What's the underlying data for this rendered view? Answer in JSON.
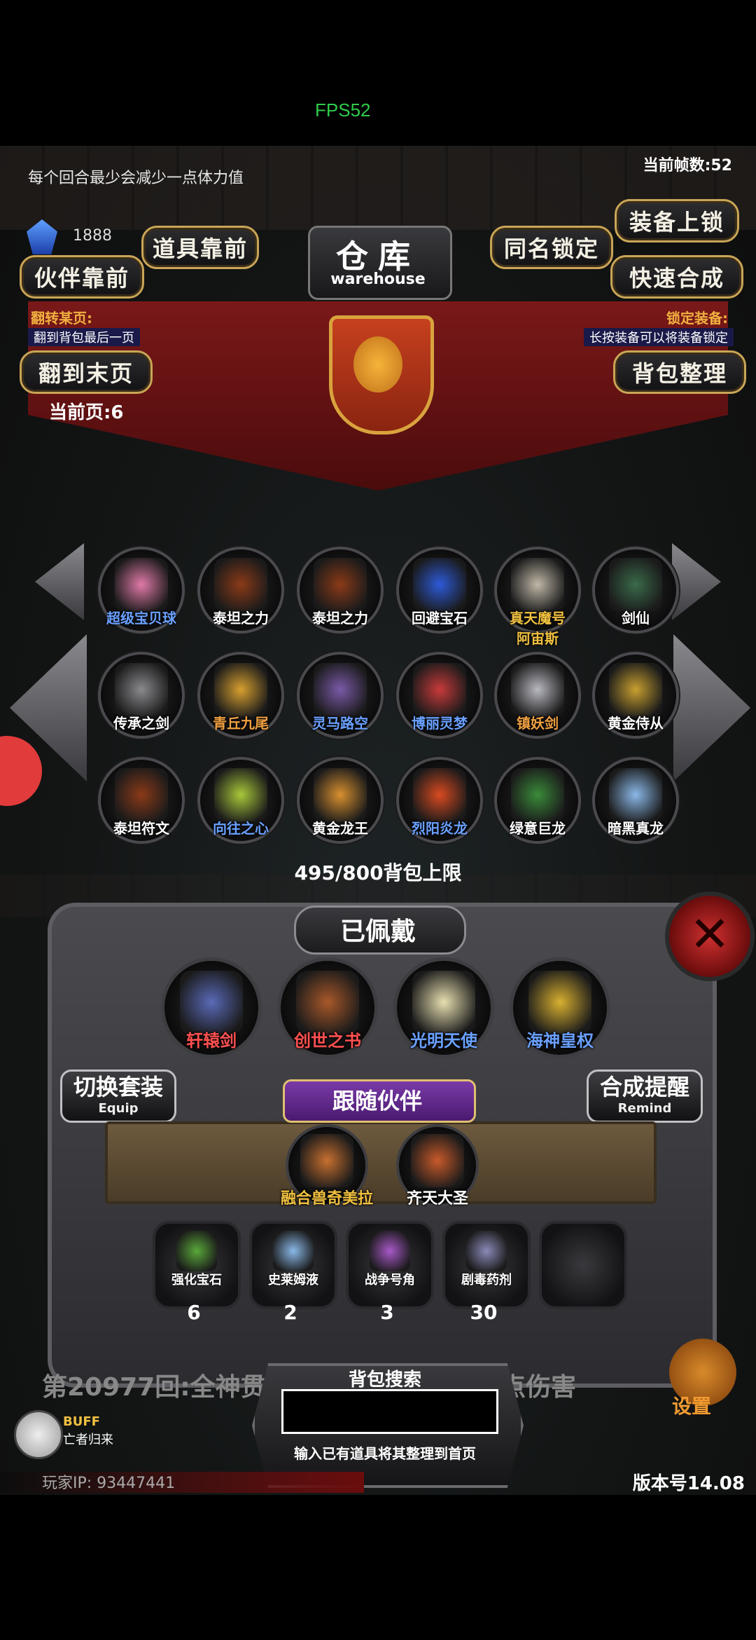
{
  "status_bar": {
    "fps": "FPS52"
  },
  "top": {
    "hint": "每个回合最少会减少一点体力值",
    "frame_rate": "当前帧数:52",
    "gem_value": "1888"
  },
  "buttons": {
    "items_front": "道具靠前",
    "partner_front": "伙伴靠前",
    "same_name_lock": "同名锁定",
    "equip_lock": "装备上锁",
    "quick_synth": "快速合成",
    "flip_last": "翻到末页",
    "bag_sort": "背包整理"
  },
  "warehouse": {
    "title": "仓库",
    "subtitle": "warehouse"
  },
  "notes": {
    "flip_title": "翻转某页:",
    "flip_desc": "翻到背包最后一页",
    "lock_title": "锁定装备:",
    "lock_desc": "长按装备可以将装备锁定"
  },
  "current_page": "当前页:6",
  "grid_items": [
    {
      "label": "超级宝贝球",
      "color": "#6aa0ff",
      "icon": "pokeball-icon",
      "tint": "#e07aa8"
    },
    {
      "label": "泰坦之力",
      "color": "#ffffff",
      "icon": "titan-stone-icon",
      "tint": "#8a3a18"
    },
    {
      "label": "泰坦之力",
      "color": "#ffffff",
      "icon": "titan-stone-icon",
      "tint": "#8a3a18"
    },
    {
      "label": "回避宝石",
      "color": "#ffffff",
      "icon": "blue-orb-icon",
      "tint": "#2d5ad8"
    },
    {
      "label": "真天魔号\n阿宙斯",
      "color": "#f0c040",
      "icon": "arceus-icon",
      "tint": "#c0b8a8"
    },
    {
      "label": "剑仙",
      "color": "#ffffff",
      "icon": "sword-immortal-icon",
      "tint": "#3a6a4a"
    },
    {
      "label": "传承之剑",
      "color": "#ffffff",
      "icon": "sword-icon",
      "tint": "#8a8a8e"
    },
    {
      "label": "青丘九尾",
      "color": "#f0a040",
      "icon": "nine-tail-fox-icon",
      "tint": "#d8a030"
    },
    {
      "label": "灵马路空",
      "color": "#6aa0ff",
      "icon": "spirit-horse-icon",
      "tint": "#7a5aa8"
    },
    {
      "label": "博丽灵梦",
      "color": "#6aa0ff",
      "icon": "reimu-icon",
      "tint": "#c83a3a"
    },
    {
      "label": "镇妖剑",
      "color": "#f0a040",
      "icon": "demon-sword-icon",
      "tint": "#b8b8c0"
    },
    {
      "label": "黄金侍从",
      "color": "#ffffff",
      "icon": "golden-servant-icon",
      "tint": "#c8a030"
    },
    {
      "label": "泰坦符文",
      "color": "#ffffff",
      "icon": "titan-rune-icon",
      "tint": "#8a3a18"
    },
    {
      "label": "向往之心",
      "color": "#6aa0ff",
      "icon": "heart-icon",
      "tint": "#a8c83a"
    },
    {
      "label": "黄金龙王",
      "color": "#ffffff",
      "icon": "golden-dragon-icon",
      "tint": "#d89030"
    },
    {
      "label": "烈阳炎龙",
      "color": "#6aa0ff",
      "icon": "fire-dragon-icon",
      "tint": "#d84a20"
    },
    {
      "label": "绿意巨龙",
      "color": "#ffffff",
      "icon": "green-dragon-icon",
      "tint": "#3a8a3a"
    },
    {
      "label": "暗黑真龙",
      "color": "#ffffff",
      "icon": "dark-dragon-icon",
      "tint": "#8ab8e8"
    }
  ],
  "capacity": "495/800背包上限",
  "equipped": {
    "title": "已佩戴",
    "items": [
      {
        "label": "轩辕剑",
        "color": "#ff5050",
        "icon": "xuanyuan-sword-icon",
        "tint": "#5a6ab8"
      },
      {
        "label": "创世之书",
        "color": "#ff5050",
        "icon": "book-icon",
        "tint": "#a8582a"
      },
      {
        "label": "光明天使",
        "color": "#6aa0ff",
        "icon": "angel-icon",
        "tint": "#e8e0b0"
      },
      {
        "label": "海神皇权",
        "color": "#6aa0ff",
        "icon": "scepter-icon",
        "tint": "#d8b030"
      }
    ]
  },
  "switch_set": {
    "main": "切换套装",
    "sub": "Equip"
  },
  "synth_remind": {
    "main": "合成提醒",
    "sub": "Remind"
  },
  "partners": {
    "title": "跟随伙伴",
    "items": [
      {
        "label": "融合兽奇美拉",
        "color": "#f0c040",
        "icon": "chimera-icon",
        "tint": "#c87030"
      },
      {
        "label": "齐天大圣",
        "color": "#ffffff",
        "icon": "monkey-king-icon",
        "tint": "#c85a2a"
      }
    ]
  },
  "consumables": [
    {
      "label": "强化宝石",
      "count": "6",
      "icon": "green-gem-icon",
      "tint": "#5aa83a"
    },
    {
      "label": "史莱姆液",
      "count": "2",
      "icon": "slime-potion-icon",
      "tint": "#8ab8e8"
    },
    {
      "label": "战争号角",
      "count": "3",
      "icon": "war-horn-icon",
      "tint": "#a858c8"
    },
    {
      "label": "剧毒药剂",
      "count": "30",
      "icon": "poison-potion-icon",
      "tint": "#8a8ab8"
    }
  ],
  "battle_log": "第20977回:全神贯注... 兽造成59 953点伤害",
  "search": {
    "label": "背包搜索",
    "placeholder": "",
    "hint": "输入已有道具将其整理到首页"
  },
  "player_ip": "玩家IP: 93447441",
  "version": "版本号14.08",
  "settings_label": "设置",
  "buff": {
    "title": "BUFF",
    "desc": "亡者归来"
  },
  "close_glyph": "✕"
}
